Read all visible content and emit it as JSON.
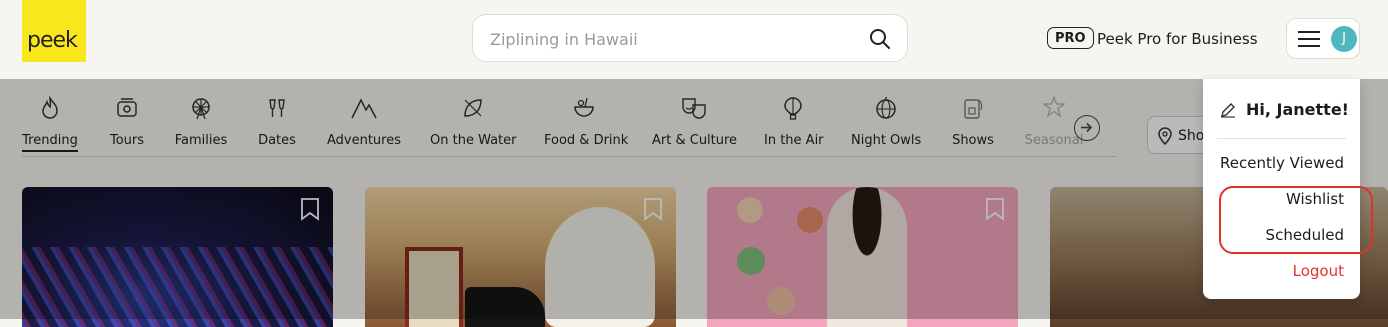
{
  "header": {
    "logo_text": "peek",
    "search_placeholder": "Ziplining in Hawaii",
    "pro_badge": "PRO",
    "pro_text": "Peek Pro for Business",
    "avatar_initial": "J"
  },
  "categories": [
    {
      "label": "Trending",
      "icon": "flame-icon",
      "active": true
    },
    {
      "label": "Tours",
      "icon": "bus-icon"
    },
    {
      "label": "Families",
      "icon": "ferris-wheel-icon"
    },
    {
      "label": "Dates",
      "icon": "champagne-glasses-icon"
    },
    {
      "label": "Adventures",
      "icon": "mountain-icon"
    },
    {
      "label": "On the Water",
      "icon": "surfboard-icon"
    },
    {
      "label": "Food & Drink",
      "icon": "food-bowl-icon"
    },
    {
      "label": "Art & Culture",
      "icon": "theater-masks-icon"
    },
    {
      "label": "In the Air",
      "icon": "hot-air-balloon-icon"
    },
    {
      "label": "Night Owls",
      "icon": "disco-ball-icon"
    },
    {
      "label": "Shows",
      "icon": "ticket-icon"
    },
    {
      "label": "Seasonal",
      "icon": "star-icon",
      "faded": true
    }
  ],
  "location_button": "Sho",
  "dropdown": {
    "greeting": "Hi, Janette!",
    "items": [
      "Recently Viewed",
      "Wishlist",
      "Scheduled"
    ],
    "logout": "Logout"
  },
  "colors": {
    "brand_yellow": "#f8e71c",
    "avatar": "#4fb7bf",
    "logout_red": "#e0342b",
    "highlight": "#e0342b"
  }
}
